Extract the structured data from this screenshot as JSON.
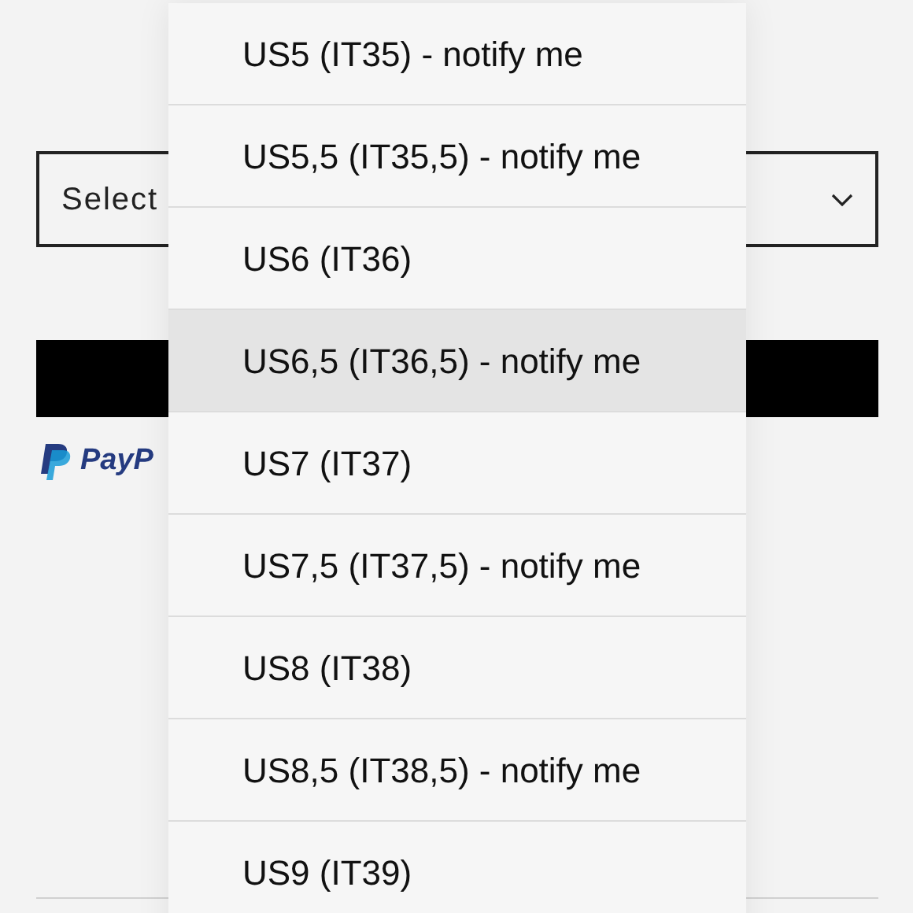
{
  "size_select": {
    "placeholder": "Select"
  },
  "payment": {
    "brand_text": "PayP"
  },
  "options": [
    {
      "label": "US5 (IT35) - notify me",
      "selected": false
    },
    {
      "label": "US5,5 (IT35,5) - notify me",
      "selected": false
    },
    {
      "label": "US6 (IT36)",
      "selected": false
    },
    {
      "label": "US6,5 (IT36,5) - notify me",
      "selected": true
    },
    {
      "label": "US7 (IT37)",
      "selected": false
    },
    {
      "label": "US7,5 (IT37,5) - notify me",
      "selected": false
    },
    {
      "label": "US8 (IT38)",
      "selected": false
    },
    {
      "label": "US8,5 (IT38,5) - notify me",
      "selected": false
    },
    {
      "label": "US9 (IT39)",
      "selected": false
    }
  ]
}
